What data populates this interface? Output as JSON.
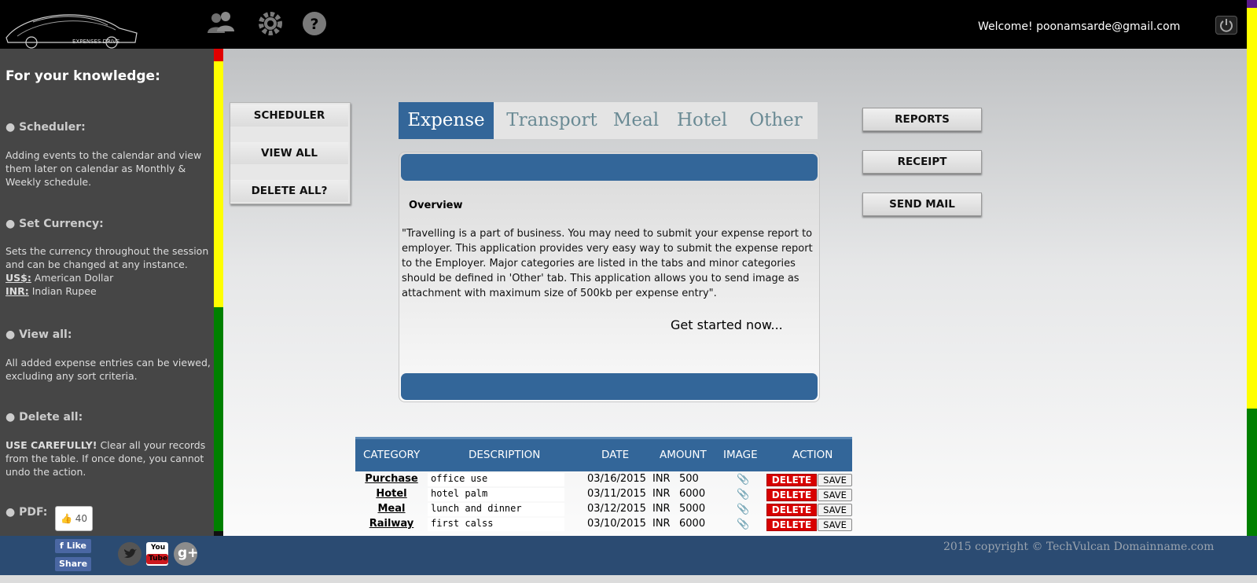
{
  "header": {
    "logo_text": "EXPENSES DRIVE",
    "welcome": "Welcome! poonamsarde@gmail.com",
    "icons": [
      "users-icon",
      "gear-icon",
      "help-icon",
      "power-icon"
    ]
  },
  "sidebar": {
    "title": "For your knowledge:",
    "sections": [
      {
        "heading": "● Scheduler:",
        "text": "Adding events to the calendar and view them later on calendar as Monthly & Weekly schedule."
      },
      {
        "heading": "● Set Currency:",
        "text": "Sets the currency throughout the session and can be changed at any instance.",
        "usd_label": "US$:",
        "usd_text": " American Dollar",
        "inr_label": "INR:",
        "inr_text": " Indian Rupee"
      },
      {
        "heading": "● View all:",
        "text": "All added expense entries can be viewed, excluding any sort criteria."
      },
      {
        "heading": "● Delete all:",
        "bold": "USE CAREFULLY!",
        "text": " Clear all your records from the table. If once done, you cannot undo the action."
      },
      {
        "heading": "● PDF:"
      }
    ],
    "like_count": "40"
  },
  "left_buttons": [
    "SCHEDULER",
    "VIEW ALL",
    "DELETE ALL?"
  ],
  "right_buttons": [
    "REPORTS",
    "RECEIPT",
    "SEND MAIL"
  ],
  "tabs": [
    "Expense",
    "Transport",
    "Meal",
    "Hotel",
    "Other"
  ],
  "active_tab": "Expense",
  "overview": {
    "heading": "Overview",
    "text": "\"Travelling is a part of business. You may need to submit your expense report to employer. This application provides very easy way to submit the expense report to the Employer. Major categories are listed in the tabs and minor categories should be defined in 'Other' tab. This application allows you to send image as attachment with maximum size of 500kb per expense entry\".",
    "cta": "Get started now..."
  },
  "table": {
    "headers": [
      "CATEGORY",
      "DESCRIPTION",
      "DATE",
      "AMOUNT",
      "IMAGE",
      "ACTION"
    ],
    "delete_label": "DELETE",
    "save_label": "SAVE",
    "rows": [
      {
        "category": "Purchase",
        "description": "office use",
        "date": "03/16/2015",
        "currency": "INR",
        "amount": "500"
      },
      {
        "category": "Hotel",
        "description": "hotel palm",
        "date": "03/11/2015",
        "currency": "INR",
        "amount": "6000"
      },
      {
        "category": "Meal",
        "description": "lunch and dinner",
        "date": "03/12/2015",
        "currency": "INR",
        "amount": "5000"
      },
      {
        "category": "Railway",
        "description": "first calss",
        "date": "03/10/2015",
        "currency": "INR",
        "amount": "6000"
      }
    ]
  },
  "footer": {
    "copyright": "2015 copyright © TechVulcan Domainname.com",
    "like_label": "Like",
    "share_label": "Share",
    "youtube_text": "You Tube"
  },
  "colors": {
    "header_bg": "#000000",
    "sidebar_bg": "#464646",
    "accent_blue": "#336699",
    "delete_red": "#d80000",
    "footer_bg": "#2b4b72"
  }
}
